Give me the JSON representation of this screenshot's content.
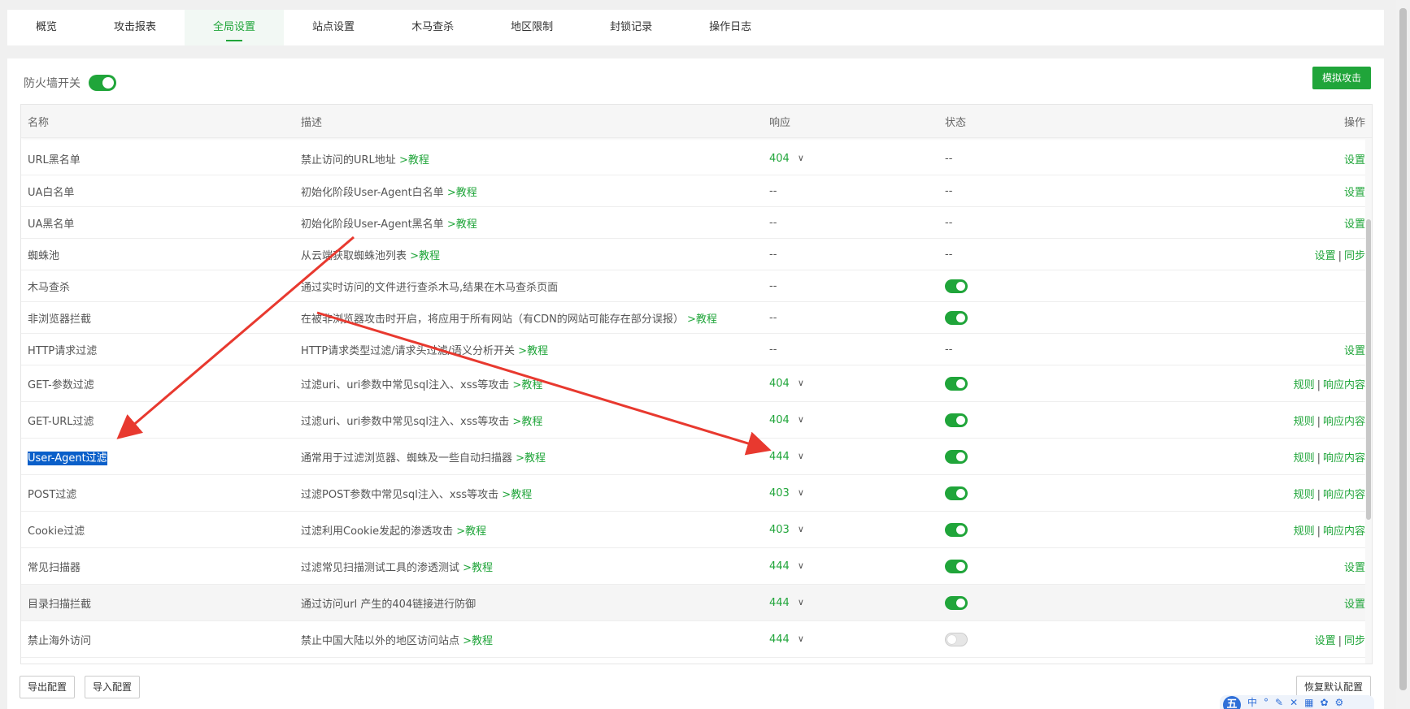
{
  "tabs": [
    {
      "label": "概览",
      "active": false
    },
    {
      "label": "攻击报表",
      "active": false
    },
    {
      "label": "全局设置",
      "active": true
    },
    {
      "label": "站点设置",
      "active": false
    },
    {
      "label": "木马查杀",
      "active": false
    },
    {
      "label": "地区限制",
      "active": false
    },
    {
      "label": "封锁记录",
      "active": false
    },
    {
      "label": "操作日志",
      "active": false
    }
  ],
  "firewall": {
    "label": "防火墙开关",
    "enabled": true
  },
  "simulate_button": "模拟攻击",
  "table": {
    "headers": {
      "name": "名称",
      "desc": "描述",
      "resp": "响应",
      "state": "状态",
      "op": "操作"
    },
    "rows": [
      {
        "name": "URL黑名单",
        "desc": "禁止访问的URL地址",
        "tutorial": ">教程",
        "resp": "404",
        "state": "--",
        "ops": [
          "设置"
        ]
      },
      {
        "name": "UA白名单",
        "desc": "初始化阶段User-Agent白名单",
        "tutorial": ">教程",
        "resp": "--",
        "state": "--",
        "ops": [
          "设置"
        ]
      },
      {
        "name": "UA黑名单",
        "desc": "初始化阶段User-Agent黑名单",
        "tutorial": ">教程",
        "resp": "--",
        "state": "--",
        "ops": [
          "设置"
        ]
      },
      {
        "name": "蜘蛛池",
        "desc": "从云端获取蜘蛛池列表",
        "tutorial": ">教程",
        "resp": "--",
        "state": "--",
        "ops": [
          "设置",
          "同步"
        ]
      },
      {
        "name": "木马查杀",
        "desc": "通过实时访问的文件进行查杀木马,结果在木马查杀页面",
        "tutorial": "",
        "resp": "--",
        "state": "on",
        "ops": []
      },
      {
        "name": "非浏览器拦截",
        "desc": "在被非浏览器攻击时开启，将应用于所有网站（有CDN的网站可能存在部分误报）",
        "tutorial": ">教程",
        "resp": "--",
        "state": "on",
        "ops": []
      },
      {
        "name": "HTTP请求过滤",
        "desc": "HTTP请求类型过滤/请求头过滤/语义分析开关",
        "tutorial": ">教程",
        "resp": "--",
        "state": "--",
        "ops": [
          "设置"
        ]
      },
      {
        "name": "GET-参数过滤",
        "desc": "过滤uri、uri参数中常见sql注入、xss等攻击",
        "tutorial": ">教程",
        "resp": "404",
        "state": "on",
        "ops": [
          "规则",
          "响应内容"
        ]
      },
      {
        "name": "GET-URL过滤",
        "desc": "过滤uri、uri参数中常见sql注入、xss等攻击",
        "tutorial": ">教程",
        "resp": "404",
        "state": "on",
        "ops": [
          "规则",
          "响应内容"
        ]
      },
      {
        "name": "User-Agent过滤",
        "desc": "通常用于过滤浏览器、蜘蛛及一些自动扫描器",
        "tutorial": ">教程",
        "resp": "444",
        "state": "on",
        "ops": [
          "规则",
          "响应内容"
        ],
        "selected": true
      },
      {
        "name": "POST过滤",
        "desc": "过滤POST参数中常见sql注入、xss等攻击",
        "tutorial": ">教程",
        "resp": "403",
        "state": "on",
        "ops": [
          "规则",
          "响应内容"
        ]
      },
      {
        "name": "Cookie过滤",
        "desc": "过滤利用Cookie发起的渗透攻击",
        "tutorial": ">教程",
        "resp": "403",
        "state": "on",
        "ops": [
          "规则",
          "响应内容"
        ]
      },
      {
        "name": "常见扫描器",
        "desc": "过滤常见扫描测试工具的渗透测试",
        "tutorial": ">教程",
        "resp": "444",
        "state": "on",
        "ops": [
          "设置"
        ]
      },
      {
        "name": "目录扫描拦截",
        "desc": "通过访问url 产生的404链接进行防御",
        "tutorial": "",
        "resp": "444",
        "state": "on",
        "ops": [
          "设置"
        ],
        "hover": true
      },
      {
        "name": "禁止海外访问",
        "desc": "禁止中国大陆以外的地区访问站点",
        "tutorial": ">教程",
        "resp": "444",
        "state": "off",
        "ops": [
          "设置",
          "同步"
        ]
      }
    ]
  },
  "footer": {
    "export": "导出配置",
    "import": "导入配置",
    "restore": "恢复默认配置"
  },
  "ime": {
    "logo": "五",
    "mode": "中"
  },
  "colors": {
    "accent": "#20a53a",
    "annotation": "#e8392f",
    "selection": "#0a5fc9"
  }
}
